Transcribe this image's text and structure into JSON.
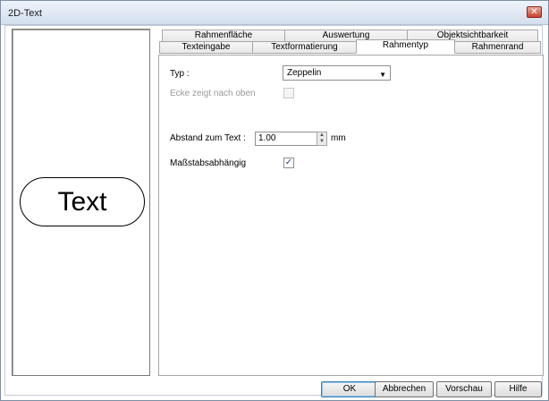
{
  "window": {
    "title": "2D-Text",
    "close_glyph": "✕"
  },
  "preview": {
    "text": "Text"
  },
  "tabs": {
    "row1": [
      "Rahmenfläche",
      "Auswertung",
      "Objektsichtbarkeit"
    ],
    "row2": [
      "Texteingabe",
      "Textformatierung",
      "Rahmentyp",
      "Rahmenrand"
    ],
    "active": "Rahmentyp"
  },
  "form": {
    "typ_label": "Typ :",
    "typ_value": "Zeppelin",
    "ecke_label": "Ecke zeigt nach oben",
    "ecke_checked": false,
    "abstand_label": "Abstand zum Text :",
    "abstand_value": "1.00",
    "abstand_unit": "mm",
    "massstab_label": "Maßstabsabhängig",
    "massstab_checked": true
  },
  "buttons": {
    "ok": "OK",
    "cancel": "Abbrechen",
    "preview": "Vorschau",
    "help": "Hilfe"
  }
}
